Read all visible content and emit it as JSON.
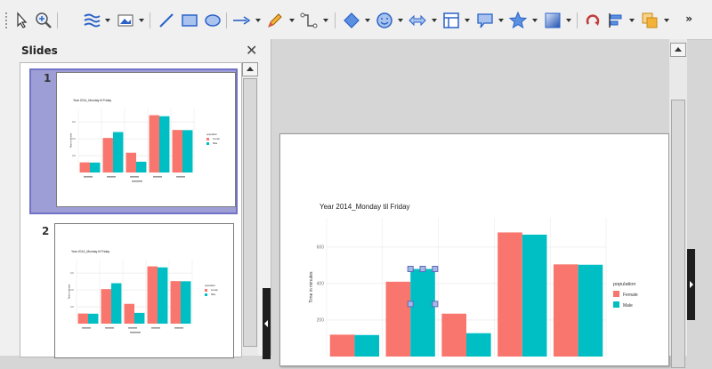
{
  "toolbar": {
    "tools": [
      {
        "icon": "select-pointer-icon",
        "has_dropdown": false
      },
      {
        "icon": "zoom-icon",
        "has_dropdown": false
      },
      {
        "icon": "line-fill-icon",
        "has_dropdown": true
      },
      {
        "icon": "image-icon",
        "has_dropdown": true
      },
      {
        "icon": "line-icon",
        "has_dropdown": false
      },
      {
        "icon": "rectangle-icon",
        "has_dropdown": false
      },
      {
        "icon": "ellipse-icon",
        "has_dropdown": false
      },
      {
        "icon": "arrow-line-icon",
        "has_dropdown": true
      },
      {
        "icon": "pencil-icon",
        "has_dropdown": true
      },
      {
        "icon": "connector-icon",
        "has_dropdown": true
      },
      {
        "icon": "diamond-shape-icon",
        "has_dropdown": true
      },
      {
        "icon": "smiley-icon",
        "has_dropdown": true
      },
      {
        "icon": "block-arrow-icon",
        "has_dropdown": true
      },
      {
        "icon": "flowchart-icon",
        "has_dropdown": true
      },
      {
        "icon": "callout-icon",
        "has_dropdown": true
      },
      {
        "icon": "star-icon",
        "has_dropdown": true
      },
      {
        "icon": "3d-object-icon",
        "has_dropdown": true
      },
      {
        "icon": "rotate-icon",
        "has_dropdown": false
      },
      {
        "icon": "align-icon",
        "has_dropdown": true
      },
      {
        "icon": "arrange-icon",
        "has_dropdown": true
      }
    ],
    "more_label": "»"
  },
  "slides_panel": {
    "title": "Slides",
    "close_label": "✕",
    "slides": [
      {
        "number": "1",
        "selected": true
      },
      {
        "number": "2",
        "selected": false
      }
    ]
  },
  "colors": {
    "female": "#f8766d",
    "male": "#00bfc4",
    "selection_bg": "#9e9ed6",
    "handle": "#5c6bb8",
    "grid": "#ebebeb"
  },
  "chart_data": [
    {
      "type": "bar",
      "title": "Year 2014_Monday til Friday",
      "xlabel": "",
      "ylabel": "Time in minutes",
      "y_ticks": [
        "200",
        "400",
        "600"
      ],
      "ylim": [
        0,
        760
      ],
      "legend_title": "population",
      "legend_position": "right",
      "categories": [
        "A",
        "B",
        "C",
        "D",
        "E"
      ],
      "series": [
        {
          "name": "Female",
          "color": "#f8766d",
          "values": [
            120,
            410,
            235,
            680,
            505
          ]
        },
        {
          "name": "Male",
          "color": "#00bfc4",
          "values": [
            118,
            480,
            128,
            668,
            503
          ]
        }
      ],
      "selected_bar": {
        "series": 1,
        "category": 1
      }
    }
  ]
}
